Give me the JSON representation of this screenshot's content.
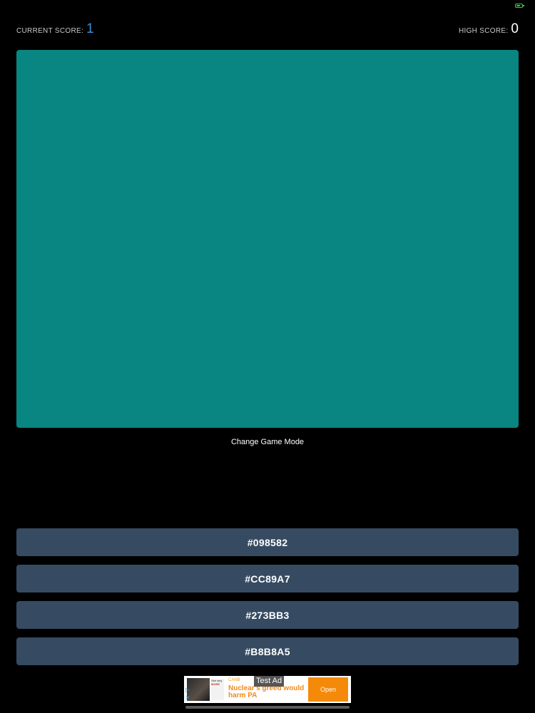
{
  "status": {
    "battery_icon": "battery-charging-icon",
    "battery_color": "#3ecb4a"
  },
  "scores": {
    "current_label": "CURRENT SCORE:",
    "current_value": "1",
    "high_label": "HIGH SCORE:",
    "high_value": "0"
  },
  "target": {
    "color": "#098582"
  },
  "mode_button_label": "Change Game Mode",
  "options": [
    {
      "label": "#098582"
    },
    {
      "label": "#CC89A7"
    },
    {
      "label": "#273BB3"
    },
    {
      "label": "#B8B8A5"
    }
  ],
  "ad": {
    "label": "Test Ad",
    "brand": "CANB",
    "headline": "Nuclear's greed would harm PA",
    "side_text_1": "See why",
    "side_text_2": "MORE",
    "cta": "Open",
    "play_icon": "play-icon",
    "close_icon": "close-icon"
  },
  "colors": {
    "background": "#000000",
    "current_score_accent": "#3a8fd9",
    "option_button": "#364b62",
    "ad_cta": "#f58a0a"
  }
}
